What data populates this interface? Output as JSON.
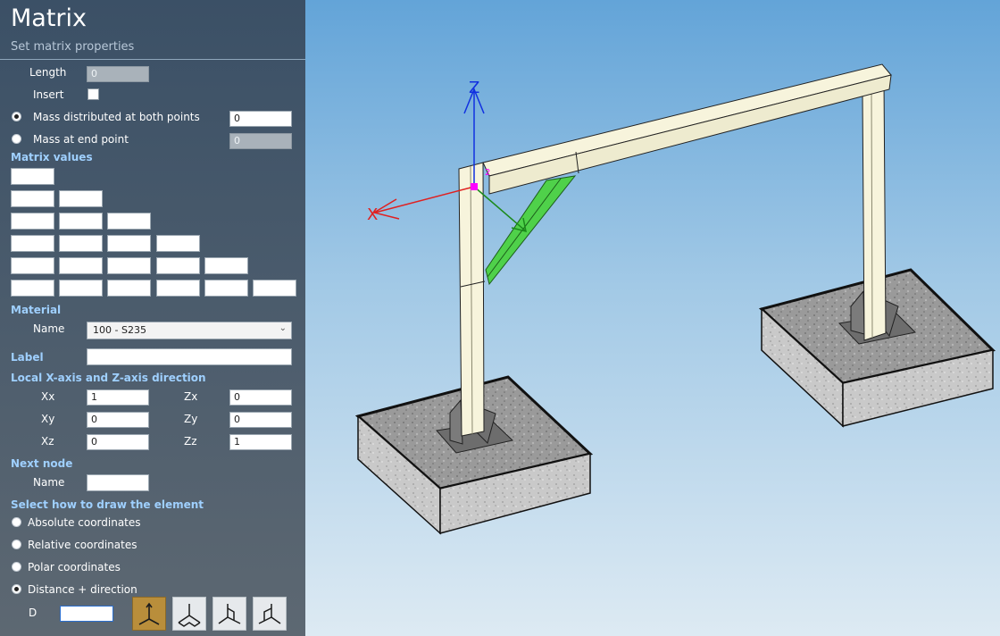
{
  "header": {
    "title": "Matrix",
    "subtitle": "Set matrix properties"
  },
  "fields": {
    "length_label": "Length",
    "length_value": "0",
    "insert_label": "Insert",
    "mass_both_label": "Mass distributed at both points",
    "mass_both_value": "0",
    "mass_end_label": "Mass at end point",
    "mass_end_value": "0"
  },
  "sections": {
    "matrix_values": "Matrix values",
    "material": "Material",
    "label": "Label",
    "local_axes": "Local X-axis and Z-axis direction",
    "next_node": "Next node",
    "draw_method": "Select how to draw the element"
  },
  "material": {
    "name_label": "Name",
    "name_value": "100 - S235"
  },
  "label_value": "",
  "axes": {
    "xx_label": "Xx",
    "xx_value": "1",
    "xy_label": "Xy",
    "xy_value": "0",
    "xz_label": "Xz",
    "xz_value": "0",
    "zx_label": "Zx",
    "zx_value": "0",
    "zy_label": "Zy",
    "zy_value": "0",
    "zz_label": "Zz",
    "zz_value": "1"
  },
  "next_node": {
    "name_label": "Name",
    "name_value": ""
  },
  "draw_options": [
    {
      "label": "Absolute coordinates",
      "selected": false
    },
    {
      "label": "Relative coordinates",
      "selected": false
    },
    {
      "label": "Polar coordinates",
      "selected": false
    },
    {
      "label": "Distance + direction",
      "selected": true
    }
  ],
  "distance": {
    "label": "D",
    "value": ""
  },
  "direction_buttons": [
    "axis-z-icon",
    "axis-xy-icon",
    "axis-yz-icon",
    "axis-xz-icon"
  ],
  "viewport": {
    "axis_z": "Z",
    "axis_x": "X",
    "node_label": "2"
  },
  "colors": {
    "accent": "#b98e3b",
    "section": "#9fd0ff",
    "member": "#f7f4dc",
    "brace": "#4fd14a",
    "x_axis": "#e02020",
    "z_axis": "#1030e0"
  }
}
